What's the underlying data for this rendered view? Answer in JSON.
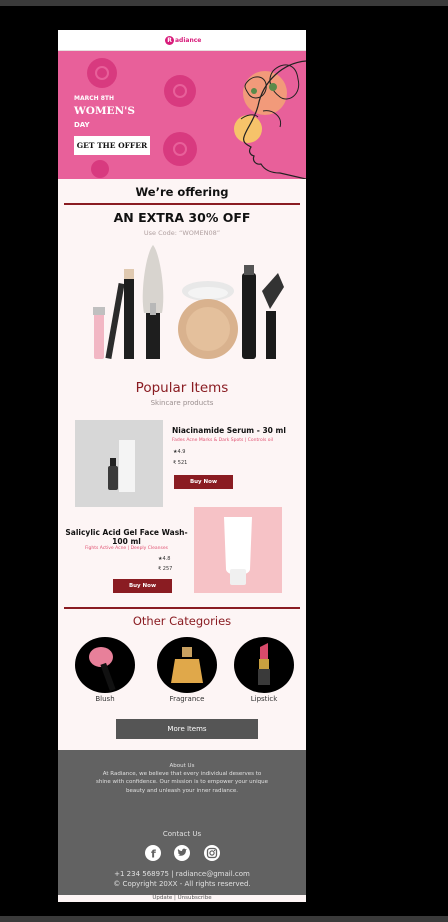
{
  "brand": {
    "logo_mark": "R",
    "logo_text": "adiance"
  },
  "banner": {
    "line1": "MARCH 8TH",
    "line2": "WOMEN'S",
    "line3": "DAY",
    "cta": "GET THE OFFER"
  },
  "offer": {
    "heading": "We’re offering",
    "headline": "AN EXTRA 30% OFF",
    "code_text": "Use Code: “WOMEN08”"
  },
  "popular": {
    "title": "Popular Items",
    "subtitle": "Skincare products",
    "items": [
      {
        "name": "Niacinamide Serum - 30 ml",
        "desc": "Fades Acne Marks & Dark Spots | Controls oil",
        "rating": "4.9",
        "price": "₹ 521",
        "button": "Buy Now"
      },
      {
        "name": "Salicylic Acid Gel Face Wash- 100 ml",
        "desc": "Fights Active Acne | Deeply Cleanses",
        "rating": "4.8",
        "price": "₹ 257",
        "button": "Buy Now"
      }
    ]
  },
  "categories": {
    "title": "Other Categories",
    "items": [
      {
        "label": "Blush",
        "icon": "blush-brush-icon"
      },
      {
        "label": "Fragrance",
        "icon": "perfume-bottle-icon"
      },
      {
        "label": "Lipstick",
        "icon": "lipstick-icon"
      }
    ],
    "more_button": "More Items"
  },
  "footer": {
    "about_title": "About Us",
    "about_text": "At Radiance, we believe that every individual deserves to shine with confidence. Our mission is to empower your unique beauty and unleash your inner radiance.",
    "contact_title": "Contact Us",
    "social": [
      "facebook-icon",
      "twitter-icon",
      "instagram-icon"
    ],
    "phone_email": "+1 234 568975 | radiance@gmail.com",
    "copyright": "© Copyright 20XX - All rights reserved."
  },
  "links": {
    "update": "Update",
    "separator": " | ",
    "unsubscribe": "Unsubscribe"
  },
  "colors": {
    "brand_pink": "#e8609a",
    "accent_maroon": "#8a1c22",
    "footer_gray": "#626262"
  }
}
